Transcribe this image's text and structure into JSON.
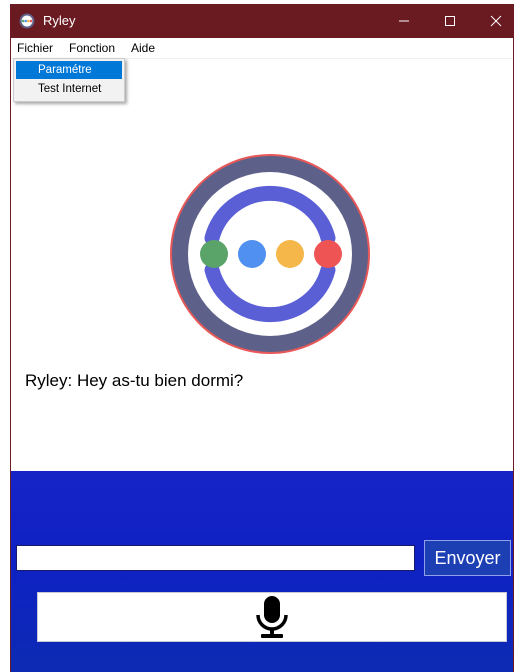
{
  "window": {
    "title": "Ryley",
    "controls": {
      "minimize": "minimize",
      "maximize": "maximize",
      "close": "close"
    }
  },
  "menubar": {
    "items": [
      {
        "label": "Fichier"
      },
      {
        "label": "Fonction"
      },
      {
        "label": "Aide"
      }
    ]
  },
  "dropdown": {
    "items": [
      {
        "label": "Paramétre",
        "highlighted": true
      },
      {
        "label": "Test Internet",
        "highlighted": false
      }
    ]
  },
  "logo": {
    "dots": [
      "#5aa469",
      "#4f90f0",
      "#f5b64a",
      "#ef5454"
    ],
    "ring_color": "#5d6189",
    "arc_color": "#5b5fd6",
    "outline_color": "#e85858"
  },
  "chat": {
    "message": "Ryley: Hey as-tu bien dormi?"
  },
  "input": {
    "value": "",
    "placeholder": ""
  },
  "send_button": {
    "label": "Envoyer"
  },
  "mic_button": {
    "icon": "microphone-icon"
  },
  "colors": {
    "titlebar": "#6a1a21",
    "panel": "#1624c6",
    "menu_highlight": "#0078d7"
  }
}
